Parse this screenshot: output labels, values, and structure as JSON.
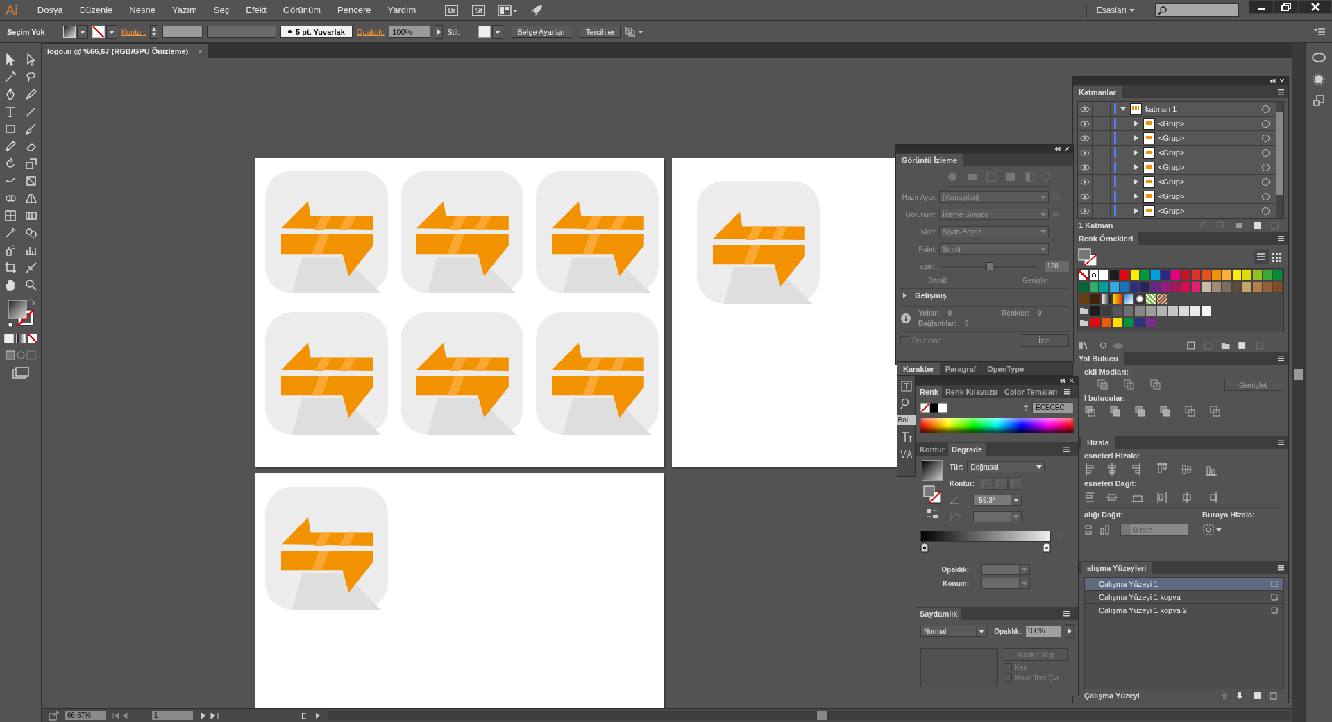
{
  "app": {
    "logo": "Ai"
  },
  "menu": [
    "Dosya",
    "Düzenle",
    "Nesne",
    "Yazım",
    "Seç",
    "Efekt",
    "Görünüm",
    "Pencere",
    "Yardım"
  ],
  "menu_icons": [
    {
      "label": "Br"
    },
    {
      "label": "St"
    }
  ],
  "workspace": {
    "label": "Esasları"
  },
  "control_bar": {
    "selection": "Seçim Yok",
    "stroke_label": "Kontur:",
    "brush": "5 pt. Yuvarlak",
    "opacity_label": "Opaklık:",
    "opacity": "100%",
    "style_label": "Stil:",
    "buttons": [
      "Belge Ayarları",
      "Tercihler"
    ]
  },
  "document_tab": {
    "title": "logo.ai @ %66,67 (RGB/GPU Önizleme)",
    "close": "×"
  },
  "image_trace": {
    "title": "Görüntü İzleme",
    "fields": [
      {
        "label": "Hazır Ayar:",
        "value": "[Varsayılan]"
      },
      {
        "label": "Görünüm:",
        "value": "İzleme Sonucu"
      },
      {
        "label": "Mod:",
        "value": "Siyah-Beyaz"
      },
      {
        "label": "Palet:",
        "value": "Sınırlı"
      }
    ],
    "threshold": {
      "label": "Eşik:",
      "value": "128",
      "level": 0.5,
      "min_label": "Daralt",
      "max_label": "Genişlet"
    },
    "advanced": {
      "label": "Gelişmiş",
      "expanded": false
    },
    "stats": [
      {
        "label": "Yollar:",
        "value": "0"
      },
      {
        "label": "Renkler:",
        "value": "0"
      },
      {
        "label": "Bağlantılar:",
        "value": "0"
      }
    ],
    "preview": {
      "label": "Önizleme",
      "checked": false
    },
    "trace_button": "İzle"
  },
  "character_panel": {
    "tabs": [
      {
        "label": "Karakter",
        "selected": true
      },
      {
        "label": "Paragraf",
        "selected": false
      },
      {
        "label": "OpenType",
        "selected": false
      }
    ],
    "font_style": "Bol"
  },
  "color_panel": {
    "tabs": [
      {
        "label": "Renk",
        "selected": true
      },
      {
        "label": "Renk Kılavuzu",
        "selected": false
      },
      {
        "label": "Color Temaları",
        "selected": false
      }
    ],
    "hex_label": "#",
    "hex": "ECECEC"
  },
  "gradient_panel": {
    "tabs": [
      {
        "label": "Kontur",
        "selected": false
      },
      {
        "label": "Degrade",
        "selected": true
      }
    ],
    "type_label": "Tür:",
    "type": "Doğrusal",
    "stroke_label": "Kontur:",
    "angle": "-59,3°",
    "opacity_label": "Opaklık:",
    "location_label": "Konum:"
  },
  "transparency_panel": {
    "tab": "Saydamlık",
    "blend_mode": "Normal",
    "opacity_label": "Opaklık:",
    "opacity": "100%",
    "mask_button": "Maske Yap",
    "options": [
      {
        "label": "Kes",
        "checked": false
      },
      {
        "label": "Mske Ters Çvr",
        "checked": false
      }
    ]
  },
  "layers_panel": {
    "title": "Katmanlar",
    "layers": [
      {
        "name": "katman 1",
        "visible": true,
        "expanded": true,
        "children": [
          {
            "name": "<Grup>",
            "visible": true,
            "expanded": false
          },
          {
            "name": "<Grup>",
            "visible": true,
            "expanded": false
          },
          {
            "name": "<Grup>",
            "visible": true,
            "expanded": false
          },
          {
            "name": "<Grup>",
            "visible": true,
            "expanded": false
          },
          {
            "name": "<Grup>",
            "visible": true,
            "expanded": false
          },
          {
            "name": "<Grup>",
            "visible": true,
            "expanded": false
          },
          {
            "name": "<Grup>",
            "visible": true,
            "expanded": false
          }
        ]
      }
    ],
    "footer": "1 Katman"
  },
  "swatches_panel": {
    "title": "Renk Örnekleri",
    "rows": [
      {
        "swatches": [
          {
            "kind": "none"
          },
          {
            "kind": "registration"
          },
          {
            "color": "#ffffff"
          },
          {
            "color": "#1d1d1b"
          },
          {
            "color": "#e30613"
          },
          {
            "color": "#ffed00"
          },
          {
            "color": "#009640"
          },
          {
            "color": "#009fe3"
          },
          {
            "color": "#312783"
          },
          {
            "color": "#e6007e"
          },
          {
            "color": "#be1622"
          },
          {
            "color": "#e42e2a"
          },
          {
            "color": "#e94e1b"
          },
          {
            "color": "#f39200"
          },
          {
            "color": "#fbb034"
          },
          {
            "color": "#fcea10"
          },
          {
            "color": "#dedc00"
          },
          {
            "color": "#95c11f"
          },
          {
            "color": "#3aaa35"
          },
          {
            "color": "#008d36"
          }
        ]
      },
      {
        "swatches": [
          {
            "color": "#006633"
          },
          {
            "color": "#2fac66"
          },
          {
            "color": "#00a19a"
          },
          {
            "color": "#36a9e1"
          },
          {
            "color": "#1d71b8"
          },
          {
            "color": "#2d2e83"
          },
          {
            "color": "#29235c"
          },
          {
            "color": "#662483"
          },
          {
            "color": "#951b81"
          },
          {
            "color": "#a2185b"
          },
          {
            "color": "#d60b52"
          },
          {
            "color": "#e71d73"
          },
          {
            "color": "#cbbba0"
          },
          {
            "color": "#a48a7b"
          },
          {
            "color": "#7d6e5b"
          },
          {
            "color": "#5d4b3c"
          },
          {
            "color": "#c9a26b"
          },
          {
            "color": "#b17f4a"
          },
          {
            "color": "#936037"
          },
          {
            "color": "#7f4f21"
          }
        ]
      },
      {
        "swatches": [
          {
            "color": "#683c11"
          },
          {
            "color": "#42210b"
          },
          {
            "kind": "gradient"
          },
          {
            "kind": "gradient"
          },
          {
            "kind": "gradient"
          },
          {
            "kind": "pattern"
          },
          {
            "kind": "pattern"
          },
          {
            "kind": "pattern"
          }
        ]
      },
      {
        "swatches": [
          {
            "kind": "folder"
          },
          {
            "color": "#1d1d1b"
          },
          {
            "color": "#3c3c3b"
          },
          {
            "color": "#575756"
          },
          {
            "color": "#706f6f"
          },
          {
            "color": "#878787"
          },
          {
            "color": "#9d9d9c"
          },
          {
            "color": "#b2b2b2"
          },
          {
            "color": "#c6c6c6"
          },
          {
            "color": "#dadada"
          },
          {
            "color": "#ededed"
          },
          {
            "color": "#f6f6f6"
          }
        ]
      },
      {
        "swatches": [
          {
            "kind": "folder"
          },
          {
            "color": "#e30613"
          },
          {
            "color": "#ea5b0c"
          },
          {
            "color": "#ffdd00"
          },
          {
            "color": "#009640"
          },
          {
            "color": "#2a3282"
          },
          {
            "color": "#7b2d8b"
          }
        ]
      }
    ]
  },
  "pathfinder_panel": {
    "title": "Yol Bulucu",
    "shape_modes_label": "ekil Modları:",
    "expand_button": "Genişlet",
    "pathfinders_label": "l bulucular:"
  },
  "align_panel": {
    "title": "Hizala",
    "align_label": "esneleri Hizala:",
    "distribute_label": "esneleri Dağıt:",
    "spacing_label": "alığı Dağıt:",
    "align_to_label": "Buraya Hizala:",
    "spacing_value": "0 mm"
  },
  "artboards_panel": {
    "title": "alışma Yüzeyleri",
    "artboards": [
      {
        "name": "Çalışma Yüzeyi 1",
        "selected": true
      },
      {
        "name": "Çalışma Yüzeyi 1 kopya",
        "selected": false
      },
      {
        "name": "Çalışma Yüzeyi 1 kopya 2",
        "selected": false
      }
    ],
    "footer": "Çalışma Yüzeyi"
  },
  "status_bar": {
    "zoom": "66.67%",
    "artboard": "1",
    "tool": "El"
  }
}
